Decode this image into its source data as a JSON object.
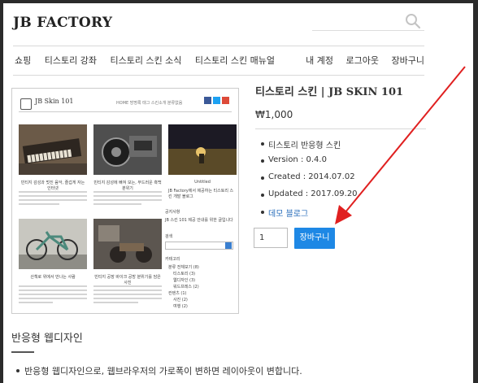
{
  "header": {
    "brand": "JB FACTORY",
    "nav_left": [
      "쇼핑",
      "티스토리 강좌",
      "티스토리 스킨 소식",
      "티스토리 스킨 매뉴얼"
    ],
    "nav_right": [
      "내 계정",
      "로그아웃",
      "장바구니"
    ]
  },
  "product_image": {
    "title": "JB Skin 101",
    "nav": "HOME   방명록   태그   스킨소개   분류없음",
    "captions": [
      "빈티지 감성과 멋진 음악, 즐겁게 자는 인터넷",
      "빈티지 감성에 빠져 보는, 부드러운 흑백 분위기",
      "Untitled",
      "산책로 위에서 만나는 사람",
      "빈티지 공장 바이크 공방 분위기를 담은 사진"
    ],
    "sidebar_heading": "공지사항",
    "sidebar_note": "JB Factory에서 제공하는 티스토리 스킨 개발 블로그",
    "sidebar_notice": "JB 스킨 101 제공 안내를 위한 글입니다",
    "sidebar_search_heading": "검색",
    "sidebar_category_heading": "카테고리",
    "categories": [
      "분류 전체보기 (8)",
      "티스토리 (3)",
      "웹디자인 (3)",
      "워드프레스 (2)",
      "컨텐츠 (1)",
      "사진 (2)",
      "여행 (2)",
      "기타 (1)"
    ]
  },
  "product": {
    "title": "티스토리 스킨 | JB SKIN 101",
    "price": "₩1,000",
    "specs": [
      "티스토리 반응형 스킨",
      "Version : 0.4.0",
      "Created : 2014.07.02",
      "Updated : 2017.09.20"
    ],
    "demo_link": "데모 블로그",
    "quantity": "1",
    "cart_button": "장바구니"
  },
  "section": {
    "title": "반응형 웹디자인",
    "desc": "반응형 웹디자인으로, 웹브라우저의 가로폭이 변하면 레이아웃이 변합니다."
  },
  "colors": {
    "accent": "#1e88e5",
    "arrow": "#e02020",
    "link": "#2a6ebb"
  }
}
